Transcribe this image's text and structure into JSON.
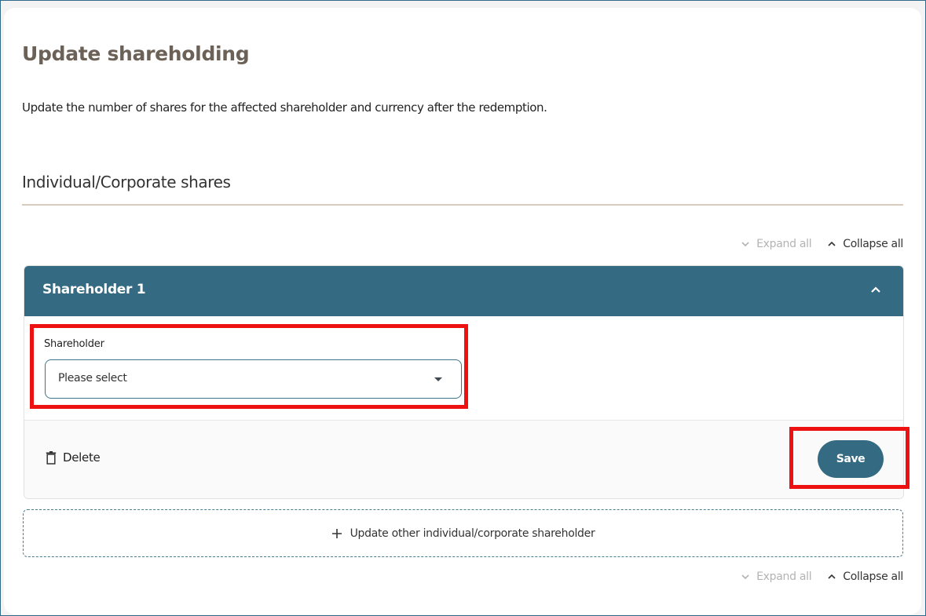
{
  "page": {
    "title": "Update shareholding",
    "description": "Update the number of shares for the affected shareholder and currency after the redemption.",
    "section_title": "Individual/Corporate shares"
  },
  "controls": {
    "expand_all": "Expand all",
    "collapse_all": "Collapse all"
  },
  "accordion": {
    "title": "Shareholder 1",
    "field_label": "Shareholder",
    "select_value": "Please select",
    "delete_label": "Delete",
    "save_label": "Save"
  },
  "add_other_label": "Update other individual/corporate shareholder",
  "colors": {
    "accent": "#356b82",
    "highlight": "#ee1111",
    "title": "#6b6157"
  },
  "icons": [
    "chevron-down-icon",
    "chevron-up-icon",
    "trash-icon",
    "plus-icon",
    "caret-down-icon"
  ]
}
